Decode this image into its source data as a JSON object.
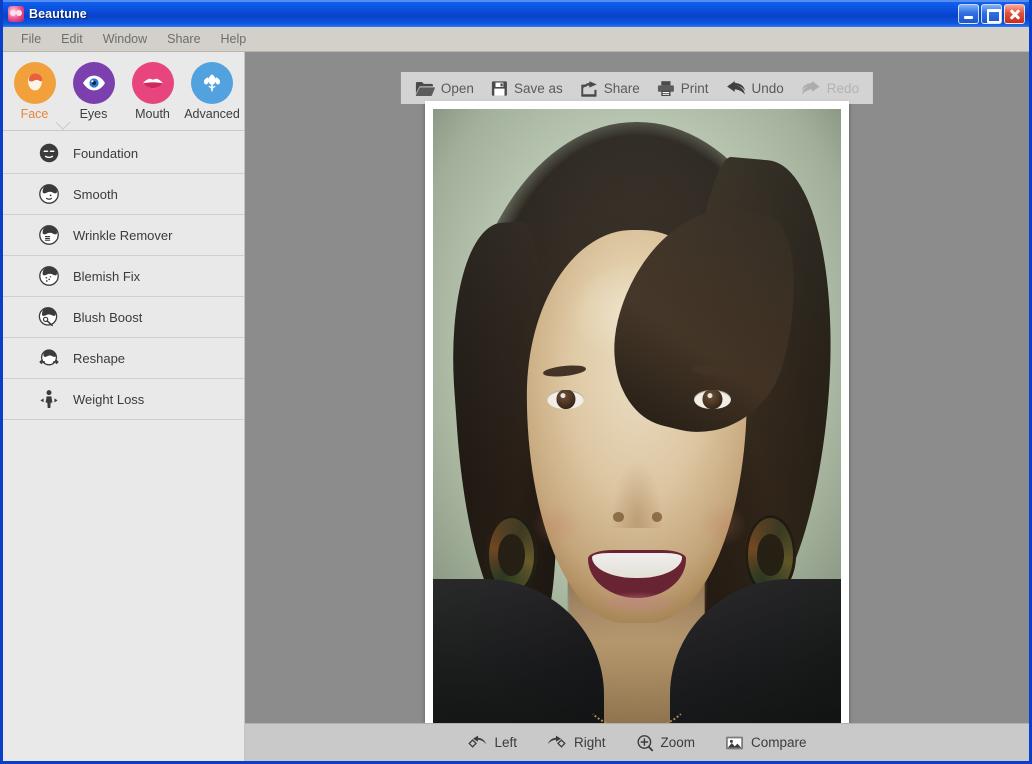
{
  "window": {
    "title": "Beautune",
    "app_icon": "app-logo-icon",
    "controls": {
      "minimize": "minimize-button",
      "maximize": "maximize-button",
      "close": "close-button"
    }
  },
  "menubar": {
    "items": [
      {
        "label": "File"
      },
      {
        "label": "Edit"
      },
      {
        "label": "Window"
      },
      {
        "label": "Share"
      },
      {
        "label": "Help"
      }
    ]
  },
  "sidebar": {
    "categories": [
      {
        "label": "Face",
        "icon": "face-icon",
        "color": "#f2a03c",
        "active": true
      },
      {
        "label": "Eyes",
        "icon": "eye-icon",
        "color": "#7b3fae",
        "active": false
      },
      {
        "label": "Mouth",
        "icon": "lips-icon",
        "color": "#e8447e",
        "active": false
      },
      {
        "label": "Advanced",
        "icon": "flower-icon",
        "color": "#52a2e0",
        "active": false
      }
    ],
    "tools": [
      {
        "label": "Foundation",
        "icon": "foundation-face-icon"
      },
      {
        "label": "Smooth",
        "icon": "smooth-face-icon"
      },
      {
        "label": "Wrinkle Remover",
        "icon": "wrinkle-face-icon"
      },
      {
        "label": "Blemish Fix",
        "icon": "blemish-face-icon"
      },
      {
        "label": "Blush Boost",
        "icon": "blush-face-icon"
      },
      {
        "label": "Reshape",
        "icon": "reshape-face-icon"
      },
      {
        "label": "Weight Loss",
        "icon": "weight-loss-icon"
      }
    ]
  },
  "top_toolbar": {
    "buttons": [
      {
        "label": "Open",
        "icon": "folder-open-icon",
        "disabled": false
      },
      {
        "label": "Save as",
        "icon": "floppy-disk-icon",
        "disabled": false
      },
      {
        "label": "Share",
        "icon": "share-arrow-icon",
        "disabled": false
      },
      {
        "label": "Print",
        "icon": "printer-icon",
        "disabled": false
      },
      {
        "label": "Undo",
        "icon": "undo-arrow-icon",
        "disabled": false
      },
      {
        "label": "Redo",
        "icon": "redo-arrow-icon",
        "disabled": true
      }
    ]
  },
  "bottom_toolbar": {
    "buttons": [
      {
        "label": "Left",
        "icon": "rotate-left-icon"
      },
      {
        "label": "Right",
        "icon": "rotate-right-icon"
      },
      {
        "label": "Zoom",
        "icon": "zoom-in-icon"
      },
      {
        "label": "Compare",
        "icon": "compare-image-icon"
      }
    ]
  },
  "canvas": {
    "photo_alt": "portrait-photo-smiling-woman",
    "background_color": "#8c8c8c",
    "card_color": "#ffffff"
  },
  "theme": {
    "titlebar_blue": "#0a4ad8",
    "menubar_gray": "#d2d0c8",
    "sidebar_gray": "#e9e9e9",
    "accent_orange": "#e8853a"
  }
}
